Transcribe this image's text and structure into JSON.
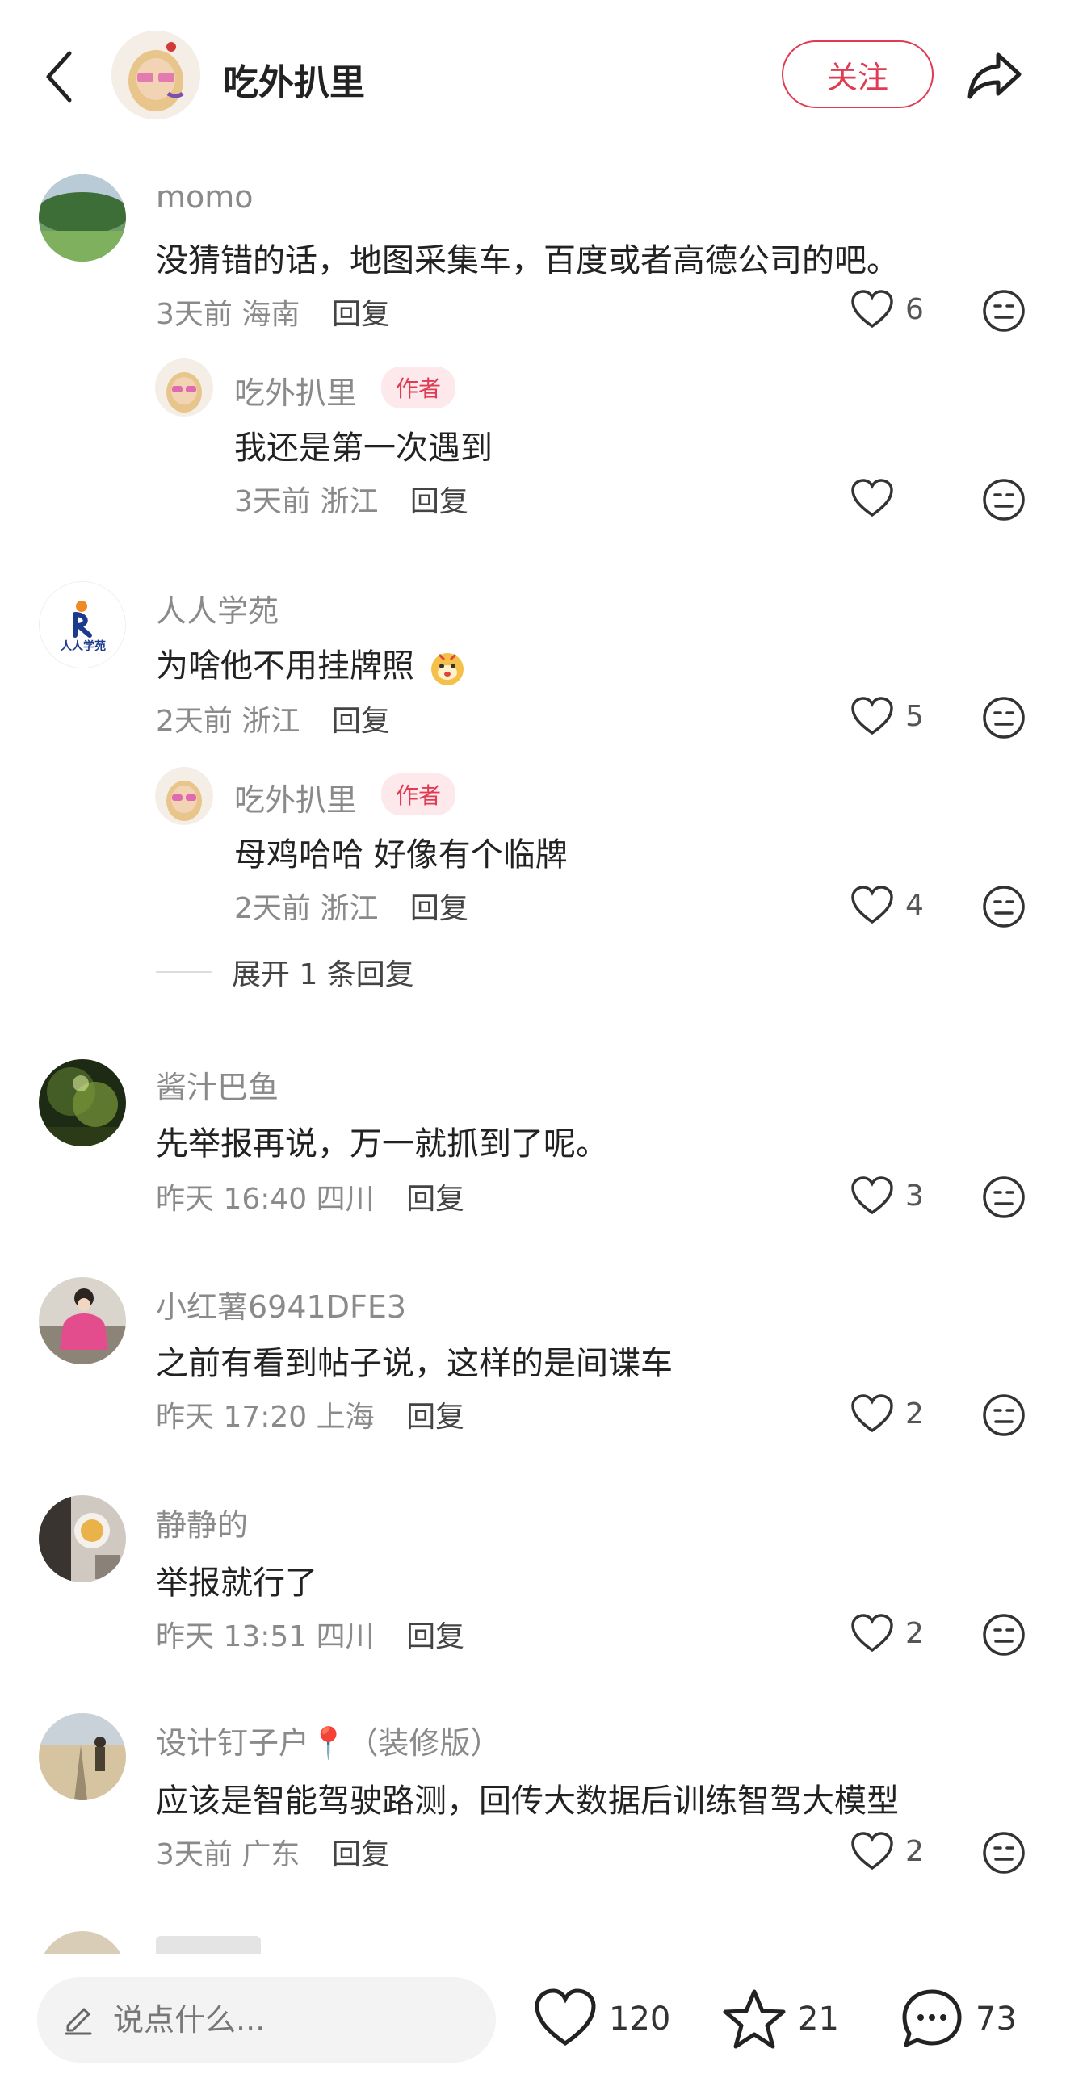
{
  "header": {
    "title": "吃外扒里",
    "follow_label": "关注",
    "icons": [
      "back-icon",
      "share-icon"
    ]
  },
  "comments": [
    {
      "user": "momo",
      "text": "没猜错的话，地图采集车，百度或者高德公司的吧。",
      "time": "3天前",
      "location": "海南",
      "reply_label": "回复",
      "likes": "6",
      "replies": [
        {
          "user": "吃外扒里",
          "badge": "作者",
          "text": "我还是第一次遇到",
          "time": "3天前",
          "location": "浙江",
          "reply_label": "回复",
          "likes": ""
        }
      ]
    },
    {
      "user": "人人学苑",
      "avatar_text": "人人学苑",
      "text": "为啥他不用挂牌照",
      "time": "2天前",
      "location": "浙江",
      "reply_label": "回复",
      "likes": "5",
      "replies": [
        {
          "user": "吃外扒里",
          "badge": "作者",
          "text": "母鸡哈哈 好像有个临牌",
          "time": "2天前",
          "location": "浙江",
          "reply_label": "回复",
          "likes": "4"
        }
      ],
      "expand_label": "展开 1 条回复"
    },
    {
      "user": "酱汁巴鱼",
      "text": "先举报再说，万一就抓到了呢。",
      "time": "昨天 16:40",
      "location": "四川",
      "reply_label": "回复",
      "likes": "3"
    },
    {
      "user": "小红薯6941DFE3",
      "text": "之前有看到帖子说，这样的是间谍车",
      "time": "昨天 17:20",
      "location": "上海",
      "reply_label": "回复",
      "likes": "2"
    },
    {
      "user": "静静的",
      "text": "举报就行了",
      "time": "昨天 13:51",
      "location": "四川",
      "reply_label": "回复",
      "likes": "2"
    },
    {
      "user": "设计钉子户📍（装修版）",
      "text": "应该是智能驾驶路测，回传大数据后训练智驾大模型",
      "time": "3天前",
      "location": "广东",
      "reply_label": "回复",
      "likes": "2"
    }
  ],
  "bottom_bar": {
    "input_placeholder": "说点什么...",
    "like_count": "120",
    "star_count": "21",
    "comment_count": "73"
  },
  "colors": {
    "accent": "#e03b52",
    "badge_bg": "#fde9ec",
    "muted_text": "#8a8a8a"
  }
}
